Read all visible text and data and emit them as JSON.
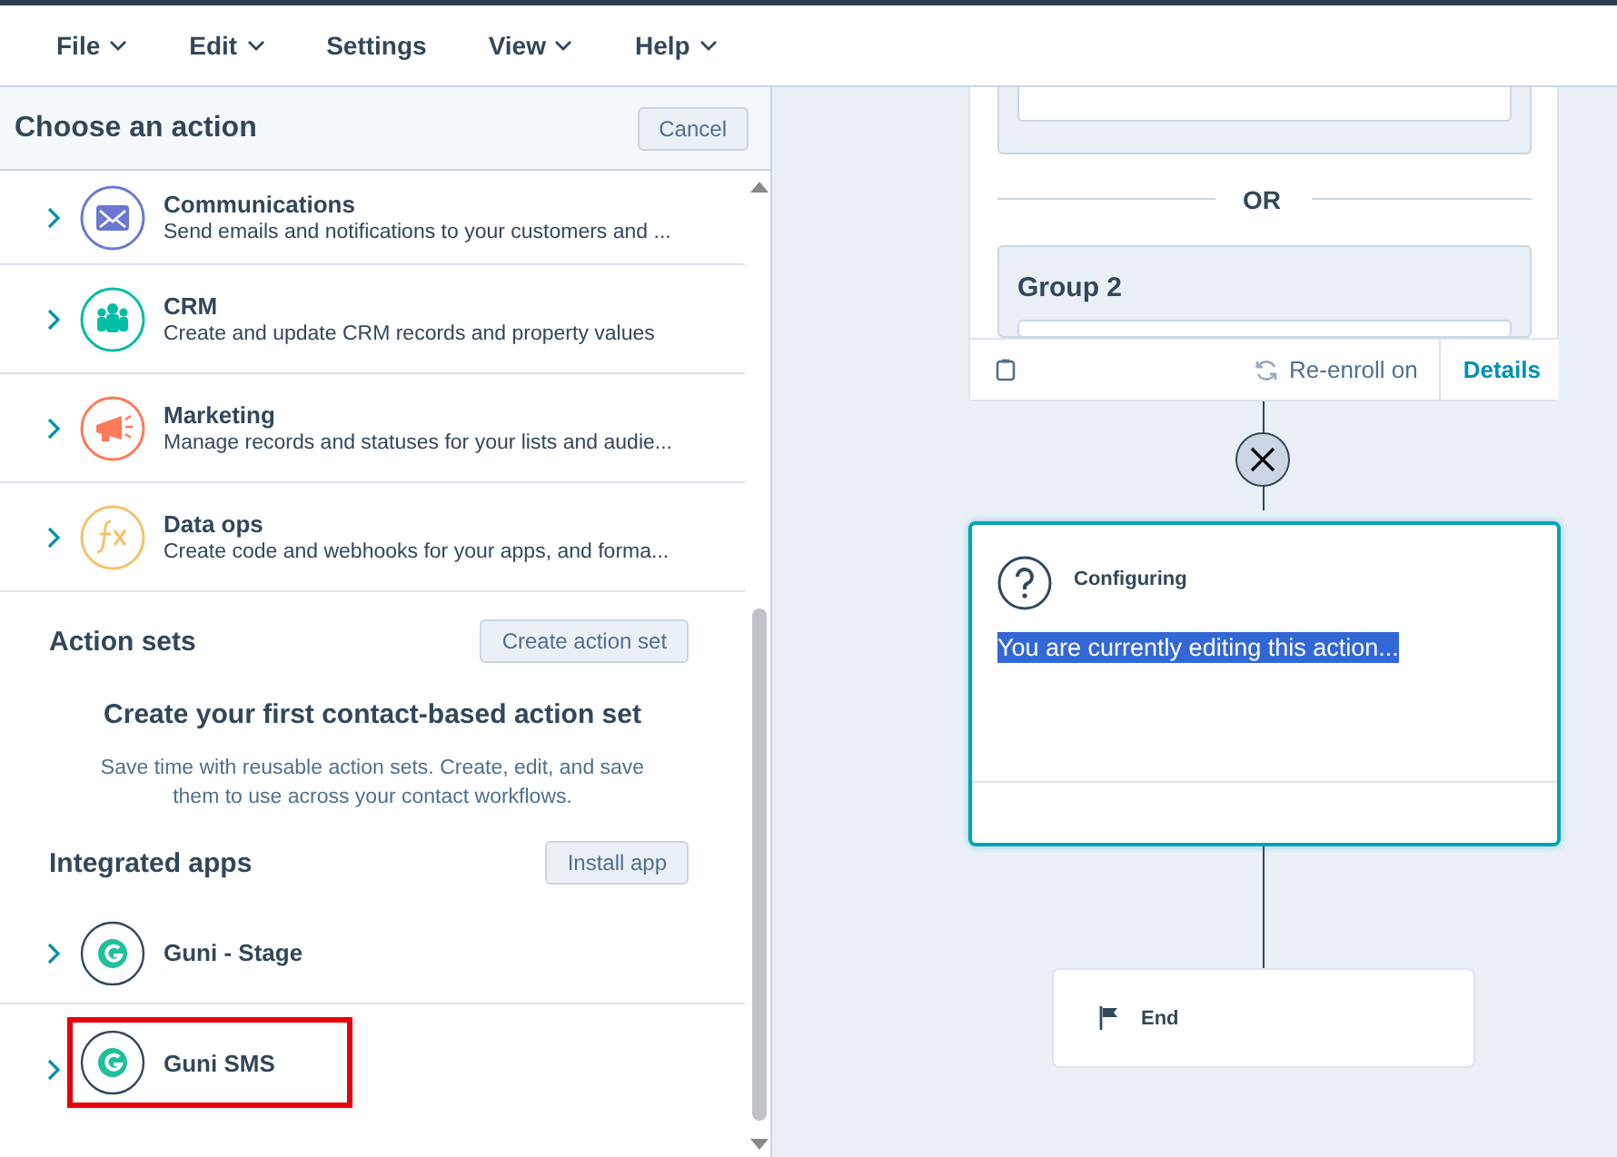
{
  "menu": [
    {
      "label": "File",
      "dropdown": true
    },
    {
      "label": "Edit",
      "dropdown": true
    },
    {
      "label": "Settings",
      "dropdown": false
    },
    {
      "label": "View",
      "dropdown": true
    },
    {
      "label": "Help",
      "dropdown": true
    }
  ],
  "panel": {
    "title": "Choose an action",
    "cancel": "Cancel",
    "categories": [
      {
        "title": "Communications",
        "description": "Send emails and notifications to your customers and ...",
        "color": "#6a78d1"
      },
      {
        "title": "CRM",
        "description": "Create and update CRM records and property values",
        "color": "#00bda5"
      },
      {
        "title": "Marketing",
        "description": "Manage records and statuses for your lists and audie...",
        "color": "#ff7a59"
      },
      {
        "title": "Data ops",
        "description": "Create code and webhooks for your apps, and forma...",
        "color": "#f5c26b"
      }
    ],
    "action_sets": {
      "heading": "Action sets",
      "button": "Create action set",
      "empty_title": "Create your first contact-based action set",
      "empty_text": "Save time with reusable action sets. Create, edit, and save them to use across your contact workflows."
    },
    "integrated_apps": {
      "heading": "Integrated apps",
      "button": "Install app",
      "apps": [
        {
          "name": "Guni - Stage",
          "highlighted": false
        },
        {
          "name": "Guni SMS",
          "highlighted": true
        }
      ]
    }
  },
  "canvas": {
    "or_label": "OR",
    "group_title": "Group 2",
    "reenroll": "Re-enroll on",
    "details": "Details",
    "configuring": {
      "title": "Configuring",
      "text": "You are currently editing this action...",
      "text_selected": true
    },
    "end": "End"
  }
}
